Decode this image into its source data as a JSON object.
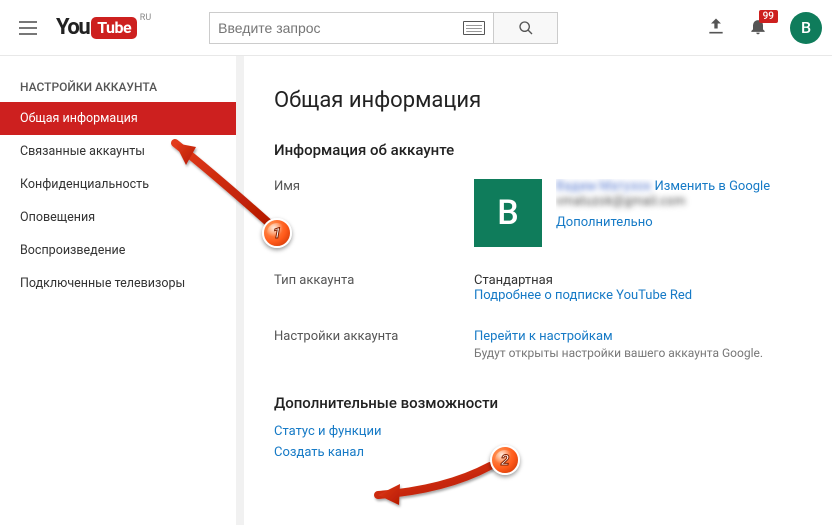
{
  "header": {
    "logo_you": "You",
    "logo_tube": "Tube",
    "logo_cc": "RU",
    "search_placeholder": "Введите запрос",
    "notif_count": "99",
    "avatar_letter": "В"
  },
  "sidebar": {
    "heading": "НАСТРОЙКИ АККАУНТА",
    "items": [
      "Общая информация",
      "Связанные аккаунты",
      "Конфиденциальность",
      "Оповещения",
      "Воспроизведение",
      "Подключенные телевизоры"
    ]
  },
  "main": {
    "title": "Общая информация",
    "account_info_h": "Информация об аккаунте",
    "name_label": "Имя",
    "avatar_letter": "В",
    "display_name": "Вадим Матузок",
    "edit_in_google": "Изменить в Google",
    "email": "vmatuzok@gmail.com",
    "more_link": "Дополнительно",
    "type_label": "Тип аккаунта",
    "type_value": "Стандартная",
    "type_link": "Подробнее о подписке YouTube Red",
    "settings_label": "Настройки аккаунта",
    "settings_link": "Перейти к настройкам",
    "settings_muted": "Будут открыты настройки вашего аккаунта Google.",
    "extra_h": "Дополнительные возможности",
    "extra_status": "Статус и функции",
    "extra_create": "Создать канал"
  }
}
